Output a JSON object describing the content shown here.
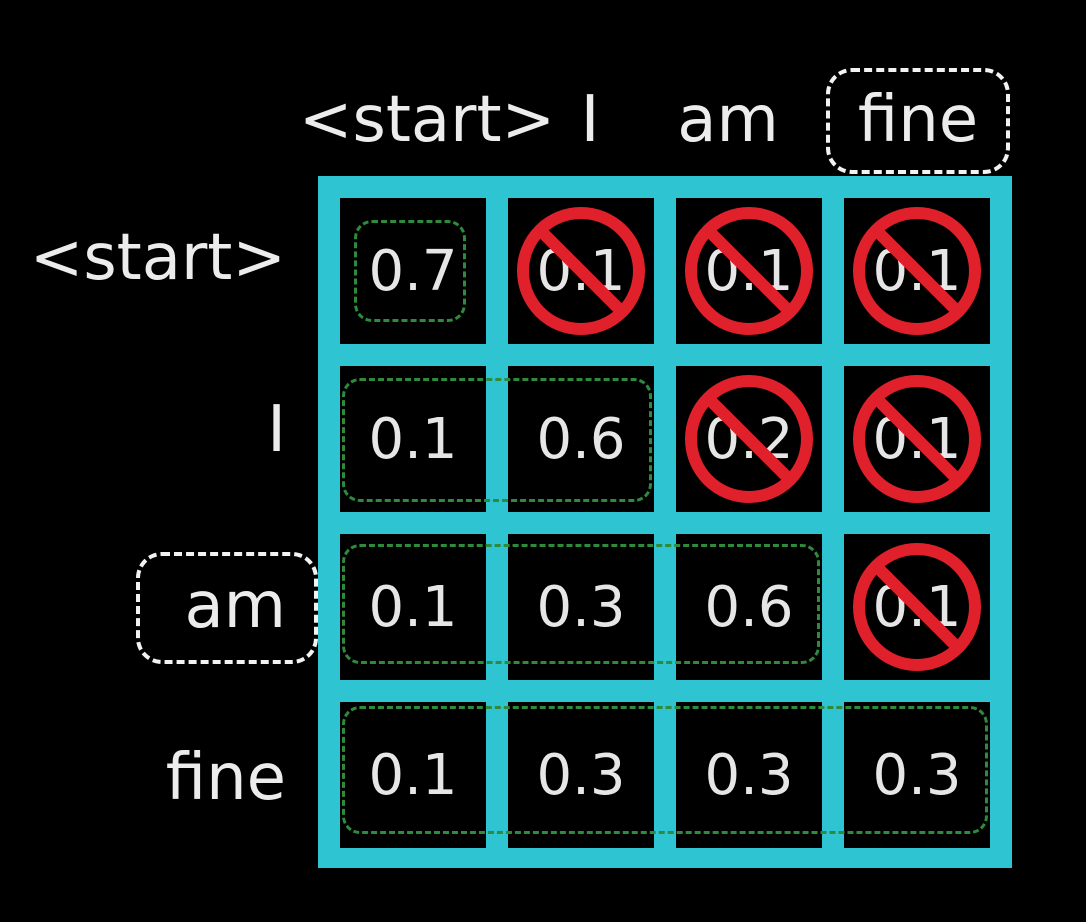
{
  "tokens": {
    "columns": [
      "<start>",
      "I",
      "am",
      "fine"
    ],
    "rows": [
      "<start>",
      "I",
      "am",
      "fine"
    ]
  },
  "matrix": [
    [
      "0.7",
      "0.1",
      "0.1",
      "0.1"
    ],
    [
      "0.1",
      "0.6",
      "0.2",
      "0.1"
    ],
    [
      "0.1",
      "0.3",
      "0.6",
      "0.1"
    ],
    [
      "0.1",
      "0.3",
      "0.3",
      "0.3"
    ]
  ],
  "masked": [
    [
      false,
      true,
      true,
      true
    ],
    [
      false,
      false,
      true,
      true
    ],
    [
      false,
      false,
      false,
      true
    ],
    [
      false,
      false,
      false,
      false
    ]
  ],
  "colors": {
    "grid": "#2ec4d2",
    "mask": "#e0202a",
    "group_outline": "#2f8a3c",
    "highlight_outline": "#f2f2f2"
  },
  "highlights": {
    "column": "fine",
    "row": "am"
  }
}
